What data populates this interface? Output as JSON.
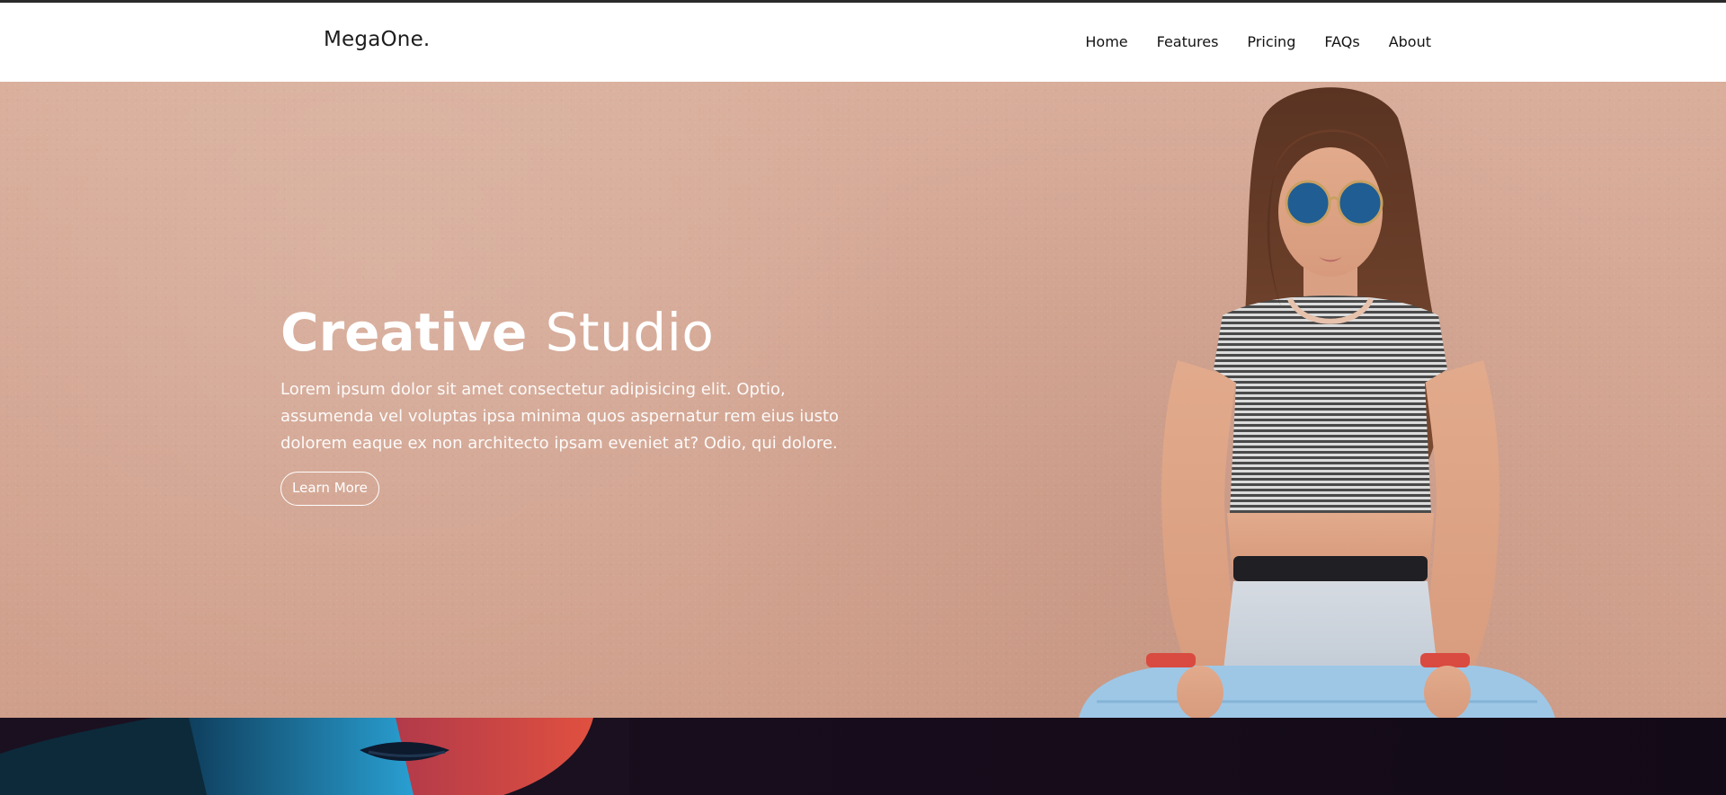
{
  "brand": "MegaOne.",
  "nav": {
    "items": [
      "Home",
      "Features",
      "Pricing",
      "FAQs",
      "About"
    ]
  },
  "hero": {
    "title_bold": "Creative",
    "title_light": "Studio",
    "text": "Lorem ipsum dolor sit amet consectetur adipisicing elit. Optio, assumenda vel voluptas ipsa minima quos aspernatur rem eius iusto dolorem eaque ex non architecto ipsam eveniet at? Odio, qui dolore.",
    "button_label": "Learn More"
  },
  "colors": {
    "hero_bg": "#d4a693",
    "strip_bg": "#170c1b",
    "text_light": "#ffffff",
    "nav_text": "#141414"
  }
}
